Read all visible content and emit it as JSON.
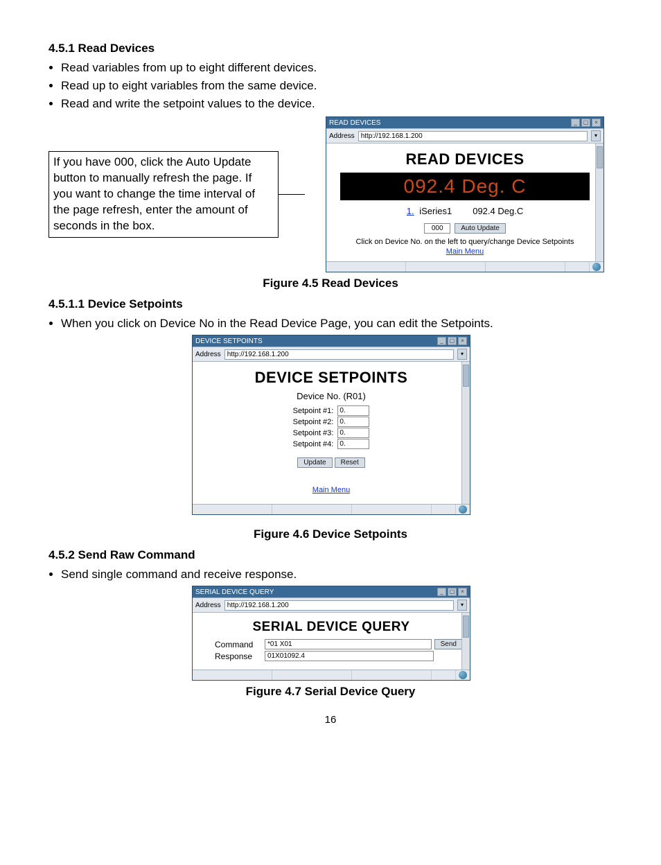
{
  "section_451": {
    "heading": "4.5.1 Read Devices",
    "bullets": [
      "Read variables from up to eight different devices.",
      "Read up to eight variables from the same device.",
      "Read and write the setpoint values to the device."
    ]
  },
  "fig45": {
    "callout": "If you have 000, click the Auto Update button to manually refresh the page. If you want to change the time interval of the page refresh, enter the amount of seconds in the box.",
    "caption": "Figure 4.5  Read Devices",
    "window": {
      "title": "READ DEVICES",
      "url": "http://192.168.1.200",
      "heading": "READ DEVICES",
      "led": "092.4  Deg. C",
      "dev_no": "1.",
      "dev_name": "iSeries1",
      "dev_value": "092.4  Deg.C",
      "auto_value": "000",
      "auto_button": "Auto Update",
      "hint": "Click on Device No. on the left to query/change Device Setpoints",
      "menu": "Main Menu"
    }
  },
  "section_4511": {
    "heading": "4.5.1.1 Device Setpoints",
    "bullets": [
      "When you click on Device No in the Read Device Page, you can edit the Setpoints."
    ]
  },
  "fig46": {
    "caption": "Figure 4.6  Device Setpoints",
    "window": {
      "title": "DEVICE SETPOINTS",
      "url": "http://192.168.1.200",
      "heading": "DEVICE SETPOINTS",
      "device_no": "Device No. (R01)",
      "sp_labels": [
        "Setpoint #1:",
        "Setpoint #2:",
        "Setpoint #3:",
        "Setpoint #4:"
      ],
      "sp_values": [
        "0.",
        "0.",
        "0.",
        "0."
      ],
      "update": "Update",
      "reset": "Reset",
      "menu": "Main Menu"
    }
  },
  "section_452": {
    "heading": "4.5.2 Send Raw Command",
    "bullets": [
      "Send single command and receive response."
    ]
  },
  "fig47": {
    "caption": "Figure 4.7  Serial Device Query",
    "window": {
      "title": "SERIAL DEVICE QUERY",
      "url": "http://192.168.1.200",
      "heading": "SERIAL DEVICE QUERY",
      "cmd_label": "Command",
      "cmd_value": "*01    X01",
      "send": "Send",
      "resp_label": "Response",
      "resp_value": "01X01092.4"
    }
  },
  "page_number": "16"
}
